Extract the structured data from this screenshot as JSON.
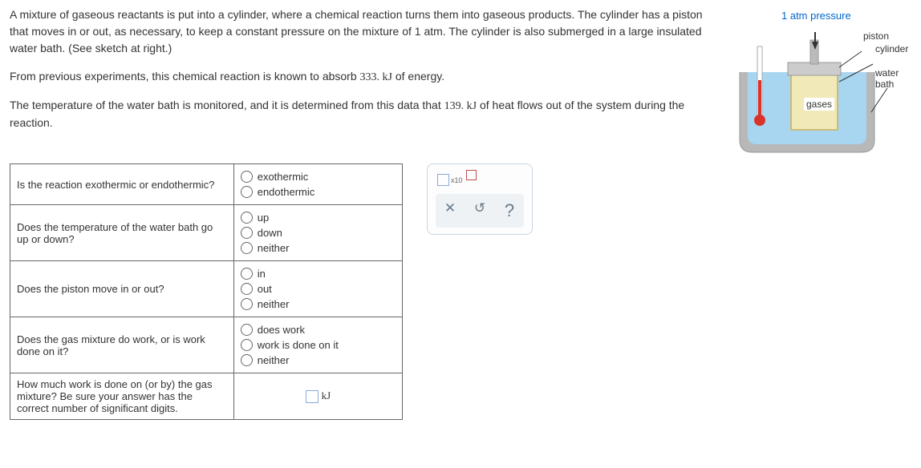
{
  "problem": {
    "p1": "A mixture of gaseous reactants is put into a cylinder, where a chemical reaction turns them into gaseous products. The cylinder has a piston that moves in or out, as necessary, to keep a constant pressure on the mixture of 1 atm. The cylinder is also submerged in a large insulated water bath. (See sketch at right.)",
    "p2_a": "From previous experiments, this chemical reaction is known to absorb ",
    "p2_v": "333. kJ",
    "p2_b": " of energy.",
    "p3_a": "The temperature of the water bath is monitored, and it is determined from this data that ",
    "p3_v": "139. kJ",
    "p3_b": " of heat flows out of the system during the reaction."
  },
  "figure": {
    "pressure_label": "1 atm pressure",
    "piston": "piston",
    "cylinder": "cylinder",
    "water_bath": "water bath",
    "gases": "gases"
  },
  "questions": {
    "q1": {
      "text": "Is the reaction exothermic or endothermic?",
      "opts": [
        "exothermic",
        "endothermic"
      ]
    },
    "q2": {
      "text": "Does the temperature of the water bath go up or down?",
      "opts": [
        "up",
        "down",
        "neither"
      ]
    },
    "q3": {
      "text": "Does the piston move in or out?",
      "opts": [
        "in",
        "out",
        "neither"
      ]
    },
    "q4": {
      "text": "Does the gas mixture do work, or is work done on it?",
      "opts": [
        "does work",
        "work is done on it",
        "neither"
      ]
    },
    "q5": {
      "text": "How much work is done on (or by) the gas mixture? Be sure your answer has the correct number of significant digits.",
      "unit": "kJ"
    }
  },
  "tools": {
    "x10": "x10"
  }
}
